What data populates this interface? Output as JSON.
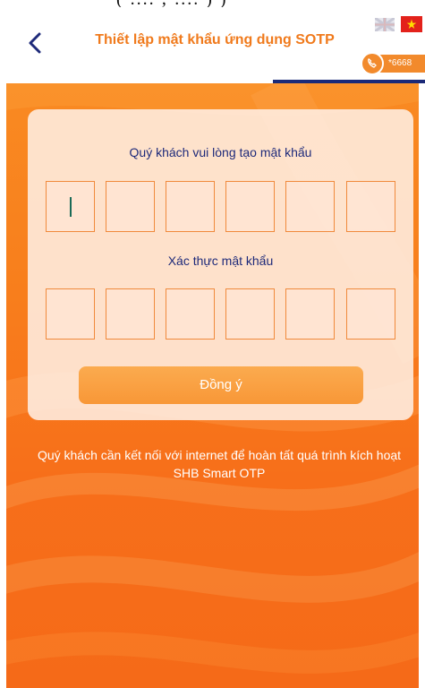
{
  "header": {
    "title": "Thiết lập mật khẩu ứng dụng SOTP",
    "back_icon": "chevron-left-icon",
    "hotline": "*6668",
    "languages": [
      "en-flag-icon",
      "vn-flag-icon"
    ]
  },
  "form": {
    "create_label": "Quý khách vui lòng tạo mật khẩu",
    "confirm_label": "Xác thực mật khẩu",
    "create_digits": [
      "",
      "",
      "",
      "",
      "",
      ""
    ],
    "confirm_digits": [
      "",
      "",
      "",
      "",
      "",
      ""
    ],
    "submit_label": "Đồng ý"
  },
  "notice": {
    "text": "Quý khách cần kết nối với internet để hoàn tất quá trình kích hoạt SHB Smart OTP"
  },
  "colors": {
    "accent": "#f07a1c",
    "navy": "#1e2a7a",
    "button": "#f89737"
  }
}
